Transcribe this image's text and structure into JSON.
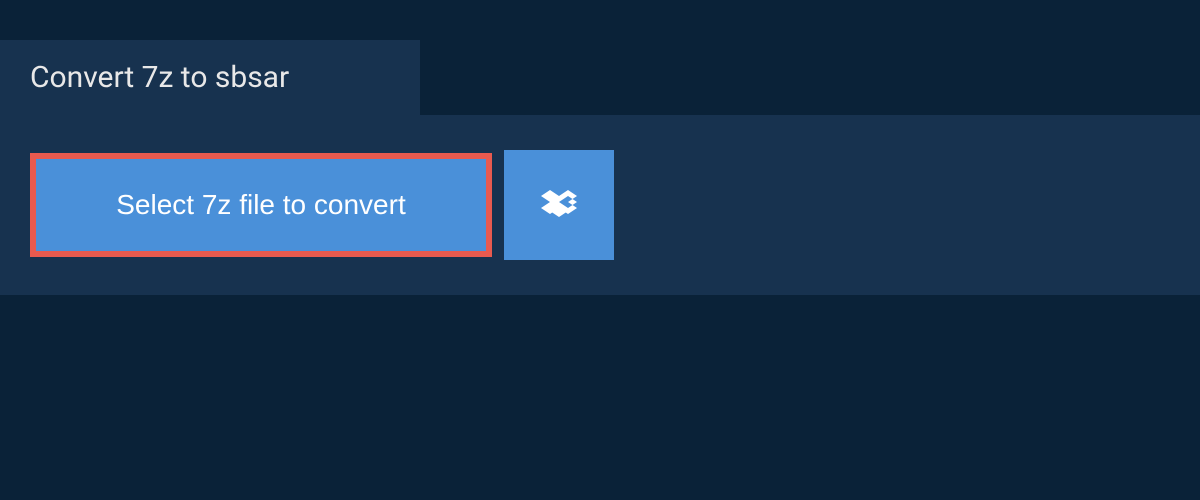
{
  "tab": {
    "title": "Convert 7z to sbsar"
  },
  "panel": {
    "select_button_label": "Select 7z file to convert"
  },
  "colors": {
    "background_dark": "#0a2238",
    "panel_bg": "#17324f",
    "button_blue": "#4a90d9",
    "highlight_border": "#e85a4f"
  }
}
